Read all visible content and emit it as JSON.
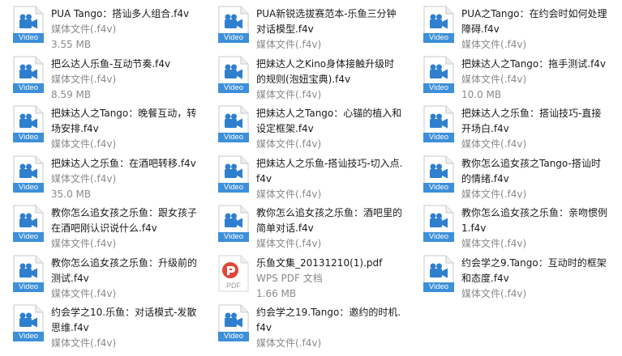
{
  "files": [
    {
      "name": "PUA Tango：搭讪多人组合.f4v",
      "line2": "媒体文件(.f4v)",
      "line3": "3.55 MB",
      "icon": "video",
      "badge": "Video"
    },
    {
      "name": "PUA新锐选拔赛范本-乐鱼三分钟对话模型.f4v",
      "line2": "媒体文件(.f4v)",
      "line3": "",
      "icon": "video",
      "badge": "Video"
    },
    {
      "name": "PUA之Tango：在约会时如何处理障碍.f4v",
      "line2": "媒体文件(.f4v)",
      "line3": "",
      "icon": "video",
      "badge": "Video"
    },
    {
      "name": "把么达人乐鱼-互动节奏.f4v",
      "line2": "媒体文件(.f4v)",
      "line3": "8.59 MB",
      "icon": "video",
      "badge": "Video"
    },
    {
      "name": "把妹达人之Kino身体接触升级时的规则(泡妞宝典).f4v",
      "line2": "媒体文件(.f4v)",
      "line3": "",
      "icon": "video",
      "badge": "Video"
    },
    {
      "name": "把妹达人之Tango：拖手测试.f4v",
      "line2": "媒体文件(.f4v)",
      "line3": "10.0 MB",
      "icon": "video",
      "badge": "Video"
    },
    {
      "name": "把妹达人之Tango：晚餐互动，转场安排.f4v",
      "line2": "媒体文件(.f4v)",
      "line3": "",
      "icon": "video",
      "badge": "Video"
    },
    {
      "name": "把妹达人之Tango：心锚的植入和设定框架.f4v",
      "line2": "媒体文件(.f4v)",
      "line3": "",
      "icon": "video",
      "badge": "Video"
    },
    {
      "name": "把妹达人之乐鱼：搭讪技巧-直接开场白.f4v",
      "line2": "媒体文件(.f4v)",
      "line3": "",
      "icon": "video",
      "badge": "Video"
    },
    {
      "name": "把妹达人之乐鱼：在酒吧转移.f4v",
      "line2": "媒体文件(.f4v)",
      "line3": "35.0 MB",
      "icon": "video",
      "badge": "Video"
    },
    {
      "name": "把妹达人之乐鱼-搭讪技巧-切入点.f4v",
      "line2": "媒体文件(.f4v)",
      "line3": "",
      "icon": "video",
      "badge": "Video"
    },
    {
      "name": "教你怎么追女孩之Tango-搭讪时的情绪.f4v",
      "line2": "媒体文件(.f4v)",
      "line3": "",
      "icon": "video",
      "badge": "Video"
    },
    {
      "name": "教你怎么追女孩之乐鱼：跟女孩子在酒吧刚认识说什么.f4v",
      "line2": "媒体文件(.f4v)",
      "line3": "",
      "icon": "video",
      "badge": "Video"
    },
    {
      "name": "教你怎么追女孩之乐鱼：酒吧里的简单对话.f4v",
      "line2": "媒体文件(.f4v)",
      "line3": "",
      "icon": "video",
      "badge": "Video"
    },
    {
      "name": "教你怎么追女孩之乐鱼：亲吻惯例1.f4v",
      "line2": "媒体文件(.f4v)",
      "line3": "",
      "icon": "video",
      "badge": "Video"
    },
    {
      "name": "教你怎么追女孩之乐鱼：升级前的测试.f4v",
      "line2": "媒体文件(.f4v)",
      "line3": "",
      "icon": "video",
      "badge": "Video"
    },
    {
      "name": "乐鱼文集_20131210(1).pdf",
      "line2": "WPS PDF 文档",
      "line3": "1.66 MB",
      "icon": "pdf",
      "badge": "PDF"
    },
    {
      "name": "约会学之9.Tango：互动时的框架和态度.f4v",
      "line2": "媒体文件(.f4v)",
      "line3": "",
      "icon": "video",
      "badge": "Video"
    },
    {
      "name": "约会学之10.乐鱼：对话模式-发散思维.f4v",
      "line2": "媒体文件(.f4v)",
      "line3": "",
      "icon": "video",
      "badge": "Video"
    },
    {
      "name": "约会学之19.Tango：邀约的时机.f4v",
      "line2": "媒体文件(.f4v)",
      "line3": "",
      "icon": "video",
      "badge": "Video"
    }
  ],
  "colors": {
    "video_badge": "#3d8fd9",
    "video_glyph": "#2f7fcf",
    "pdf_red": "#e0493b",
    "secondary_text": "#8a8a8a"
  }
}
